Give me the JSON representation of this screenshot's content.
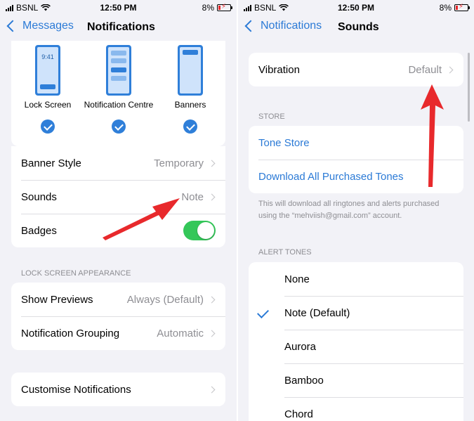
{
  "left": {
    "status": {
      "carrier": "BSNL",
      "time": "12:50 PM",
      "battery": "8%"
    },
    "nav": {
      "back_label": "Messages",
      "title": "Notifications"
    },
    "alert_styles": [
      {
        "label": "Lock Screen",
        "preview_time": "9:41",
        "checked": true
      },
      {
        "label": "Notification Centre",
        "checked": true
      },
      {
        "label": "Banners",
        "checked": true
      }
    ],
    "settings": [
      {
        "label": "Banner Style",
        "value": "Temporary"
      },
      {
        "label": "Sounds",
        "value": "Note"
      },
      {
        "label": "Badges",
        "toggle": true
      }
    ],
    "lock_section_header": "LOCK SCREEN APPEARANCE",
    "lock_settings": [
      {
        "label": "Show Previews",
        "value": "Always (Default)"
      },
      {
        "label": "Notification Grouping",
        "value": "Automatic"
      }
    ],
    "customise_label": "Customise Notifications"
  },
  "right": {
    "status": {
      "carrier": "BSNL",
      "time": "12:50 PM",
      "battery": "8%"
    },
    "nav": {
      "back_label": "Notifications",
      "title": "Sounds"
    },
    "vibration": {
      "label": "Vibration",
      "value": "Default"
    },
    "store_header": "STORE",
    "store_items": [
      "Tone Store",
      "Download All Purchased Tones"
    ],
    "store_note": "This will download all ringtones and alerts purchased using the “mehviish@gmail.com” account.",
    "alert_tones_header": "ALERT TONES",
    "alert_tones": [
      {
        "label": "None",
        "selected": false
      },
      {
        "label": "Note (Default)",
        "selected": true
      },
      {
        "label": "Aurora",
        "selected": false
      },
      {
        "label": "Bamboo",
        "selected": false
      },
      {
        "label": "Chord",
        "selected": false
      }
    ]
  },
  "colors": {
    "accent": "#2b7ad6",
    "toggle_on": "#34c759",
    "annotation": "#e8292c"
  }
}
